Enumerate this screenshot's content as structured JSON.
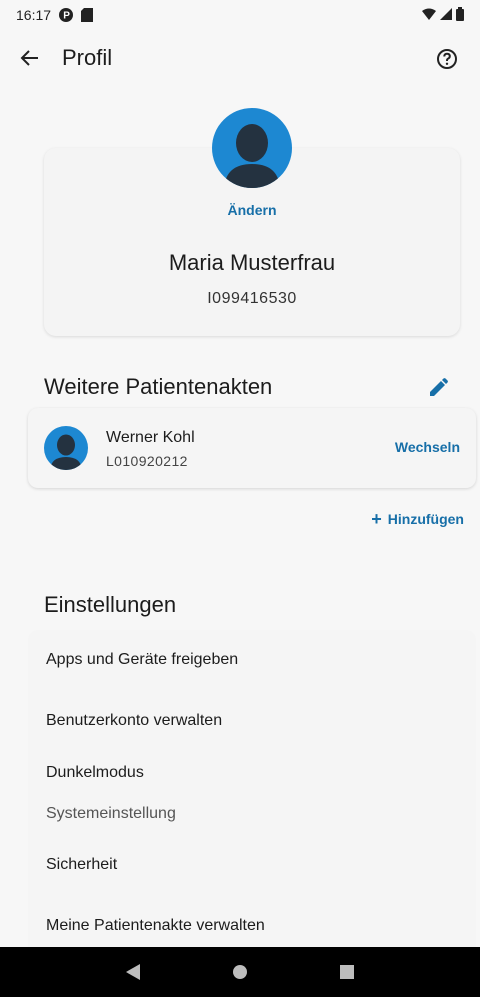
{
  "status_bar": {
    "time": "16:17",
    "icons_left": [
      "app-p-icon",
      "sd-card-icon"
    ],
    "icons_right": [
      "wifi-icon",
      "signal-icon",
      "battery-icon"
    ]
  },
  "app_bar": {
    "title": "Profil",
    "back_icon": "arrow-back-icon",
    "help_icon": "help-circle-icon"
  },
  "profile": {
    "change_label": "Ändern",
    "name": "Maria Musterfrau",
    "id": "I099416530"
  },
  "other_records": {
    "title": "Weitere Patientenakten",
    "edit_icon": "pencil-icon",
    "items": [
      {
        "name": "Werner Kohl",
        "id": "L010920212",
        "action": "Wechseln"
      }
    ],
    "add_label": "Hinzufügen"
  },
  "settings": {
    "title": "Einstellungen",
    "items": [
      {
        "label": "Apps und Geräte freigeben"
      },
      {
        "label": "Benutzerkonto verwalten"
      },
      {
        "label": "Dunkelmodus",
        "value": "Systemeinstellung"
      },
      {
        "label": "Sicherheit"
      },
      {
        "label": "Meine Patientenakte verwalten"
      }
    ]
  },
  "colors": {
    "accent": "#176fa8",
    "avatar_bg": "#1d88d2",
    "avatar_figure": "#243240",
    "background": "#f7f7f7"
  }
}
